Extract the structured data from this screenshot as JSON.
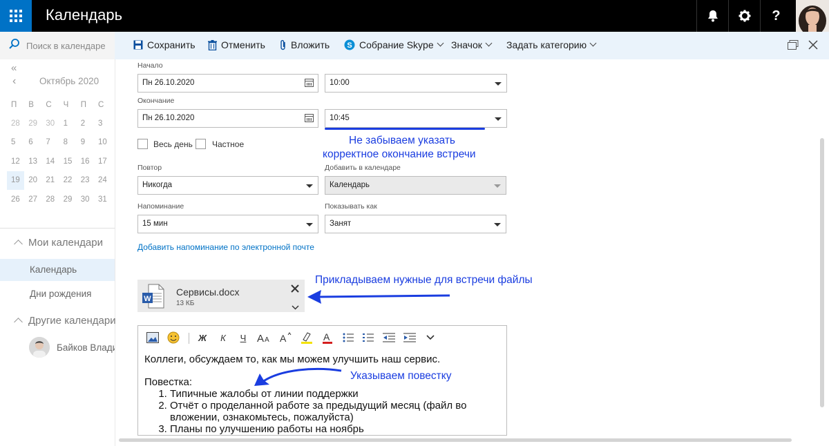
{
  "header": {
    "app_title": "Календарь",
    "waffle_icon": "app-launcher-icon",
    "notifications_icon": "bell-icon",
    "settings_icon": "gear-icon",
    "help_label": "?"
  },
  "search": {
    "placeholder": "Поиск в календаре"
  },
  "toolbar": {
    "save": "Сохранить",
    "discard": "Отменить",
    "attach": "Вложить",
    "skype": "Собрание Skype",
    "icon_menu": "Значок",
    "category": "Задать категорию"
  },
  "mini_calendar": {
    "month": "Октябрь 2020",
    "weekdays": [
      "П",
      "В",
      "С",
      "Ч",
      "П",
      "С"
    ],
    "weeks": [
      [
        "28",
        "29",
        "30",
        "1",
        "2",
        "3"
      ],
      [
        "5",
        "6",
        "7",
        "8",
        "9",
        "10"
      ],
      [
        "12",
        "13",
        "14",
        "15",
        "16",
        "17"
      ],
      [
        "19",
        "20",
        "21",
        "22",
        "23",
        "24"
      ],
      [
        "26",
        "27",
        "28",
        "29",
        "30",
        "31"
      ]
    ]
  },
  "sidebar": {
    "my_calendars": "Мои календари",
    "calendar": "Календарь",
    "birthdays": "Дни рождения",
    "other_calendars": "Другие календари",
    "person": "Байков Влади"
  },
  "form": {
    "start_label": "Начало",
    "start_date": "Пн 26.10.2020",
    "start_time": "10:00",
    "end_label": "Окончание",
    "end_date": "Пн 26.10.2020",
    "end_time": "10:45",
    "all_day": "Весь день",
    "private": "Частное",
    "repeat_label": "Повтор",
    "repeat_value": "Никогда",
    "add_to_calendar_label": "Добавить в календаре",
    "add_to_calendar_value": "Календарь",
    "reminder_label": "Напоминание",
    "reminder_value": "15 мин",
    "show_as_label": "Показывать как",
    "show_as_value": "Занят",
    "email_reminder_link": "Добавить напоминание по электронной почте"
  },
  "attachment": {
    "name": "Сервисы.docx",
    "size": "13 КБ"
  },
  "editor": {
    "toolbar": [
      "Ж",
      "К",
      "Ч"
    ],
    "intro": "Коллеги, обсуждаем то, как мы можем улучшить наш сервис.",
    "agenda_title": "Повестка:",
    "agenda_items": [
      "Типичные жалобы от линии поддержки",
      "Отчёт о проделанной работе за предыдущий месяц (файл во вложении, ознакомьтесь, пожалуйста)",
      "Планы по улучшению работы на ноябрь"
    ]
  },
  "annotations": {
    "end_time_note_1": "Не забываем указать",
    "end_time_note_2": "корректное окончание встречи",
    "attach_note": "Прикладываем нужные для встречи файлы",
    "agenda_note": "Указываем повестку"
  },
  "colors": {
    "accent": "#0072c6",
    "annotation": "#1a3de0",
    "header_bg": "#000000"
  }
}
